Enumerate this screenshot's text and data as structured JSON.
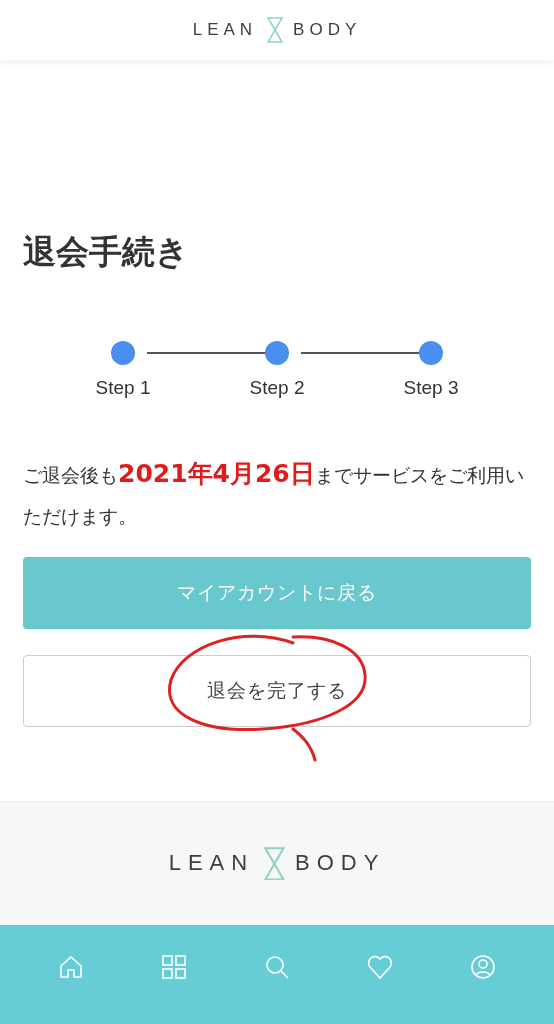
{
  "header": {
    "logo": {
      "left": "LEAN",
      "right": "BODY"
    }
  },
  "title": "退会手続き",
  "steps": [
    {
      "label": "Step 1",
      "done": true
    },
    {
      "label": "Step 2",
      "done": true
    },
    {
      "label": "Step 3",
      "done": true
    }
  ],
  "notice": [
    {
      "text": "ご退会後も",
      "emphasis": false
    },
    {
      "text": "2021年4月26日",
      "emphasis": true
    },
    {
      "text": "までサービスをご利用いただけます。",
      "emphasis": false
    }
  ],
  "buttons": [
    {
      "label": "マイアカウントに戻る",
      "kind": "primary"
    },
    {
      "label": "退会を完了する",
      "kind": "outline",
      "circled": true
    }
  ],
  "footer": {
    "logo": {
      "left": "LEAN",
      "right": "BODY"
    }
  }
}
